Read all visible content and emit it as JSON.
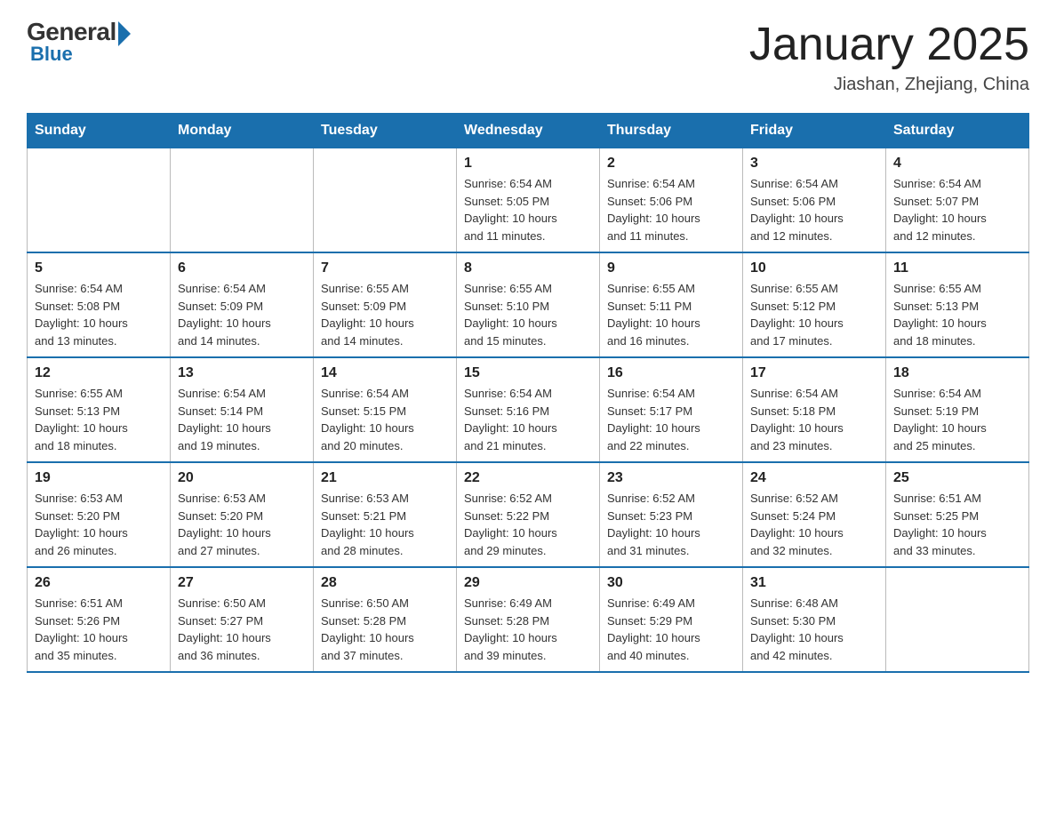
{
  "header": {
    "logo_general": "General",
    "logo_blue": "Blue",
    "month_title": "January 2025",
    "location": "Jiashan, Zhejiang, China"
  },
  "calendar": {
    "days_of_week": [
      "Sunday",
      "Monday",
      "Tuesday",
      "Wednesday",
      "Thursday",
      "Friday",
      "Saturday"
    ],
    "weeks": [
      [
        {
          "day": "",
          "info": ""
        },
        {
          "day": "",
          "info": ""
        },
        {
          "day": "",
          "info": ""
        },
        {
          "day": "1",
          "info": "Sunrise: 6:54 AM\nSunset: 5:05 PM\nDaylight: 10 hours\nand 11 minutes."
        },
        {
          "day": "2",
          "info": "Sunrise: 6:54 AM\nSunset: 5:06 PM\nDaylight: 10 hours\nand 11 minutes."
        },
        {
          "day": "3",
          "info": "Sunrise: 6:54 AM\nSunset: 5:06 PM\nDaylight: 10 hours\nand 12 minutes."
        },
        {
          "day": "4",
          "info": "Sunrise: 6:54 AM\nSunset: 5:07 PM\nDaylight: 10 hours\nand 12 minutes."
        }
      ],
      [
        {
          "day": "5",
          "info": "Sunrise: 6:54 AM\nSunset: 5:08 PM\nDaylight: 10 hours\nand 13 minutes."
        },
        {
          "day": "6",
          "info": "Sunrise: 6:54 AM\nSunset: 5:09 PM\nDaylight: 10 hours\nand 14 minutes."
        },
        {
          "day": "7",
          "info": "Sunrise: 6:55 AM\nSunset: 5:09 PM\nDaylight: 10 hours\nand 14 minutes."
        },
        {
          "day": "8",
          "info": "Sunrise: 6:55 AM\nSunset: 5:10 PM\nDaylight: 10 hours\nand 15 minutes."
        },
        {
          "day": "9",
          "info": "Sunrise: 6:55 AM\nSunset: 5:11 PM\nDaylight: 10 hours\nand 16 minutes."
        },
        {
          "day": "10",
          "info": "Sunrise: 6:55 AM\nSunset: 5:12 PM\nDaylight: 10 hours\nand 17 minutes."
        },
        {
          "day": "11",
          "info": "Sunrise: 6:55 AM\nSunset: 5:13 PM\nDaylight: 10 hours\nand 18 minutes."
        }
      ],
      [
        {
          "day": "12",
          "info": "Sunrise: 6:55 AM\nSunset: 5:13 PM\nDaylight: 10 hours\nand 18 minutes."
        },
        {
          "day": "13",
          "info": "Sunrise: 6:54 AM\nSunset: 5:14 PM\nDaylight: 10 hours\nand 19 minutes."
        },
        {
          "day": "14",
          "info": "Sunrise: 6:54 AM\nSunset: 5:15 PM\nDaylight: 10 hours\nand 20 minutes."
        },
        {
          "day": "15",
          "info": "Sunrise: 6:54 AM\nSunset: 5:16 PM\nDaylight: 10 hours\nand 21 minutes."
        },
        {
          "day": "16",
          "info": "Sunrise: 6:54 AM\nSunset: 5:17 PM\nDaylight: 10 hours\nand 22 minutes."
        },
        {
          "day": "17",
          "info": "Sunrise: 6:54 AM\nSunset: 5:18 PM\nDaylight: 10 hours\nand 23 minutes."
        },
        {
          "day": "18",
          "info": "Sunrise: 6:54 AM\nSunset: 5:19 PM\nDaylight: 10 hours\nand 25 minutes."
        }
      ],
      [
        {
          "day": "19",
          "info": "Sunrise: 6:53 AM\nSunset: 5:20 PM\nDaylight: 10 hours\nand 26 minutes."
        },
        {
          "day": "20",
          "info": "Sunrise: 6:53 AM\nSunset: 5:20 PM\nDaylight: 10 hours\nand 27 minutes."
        },
        {
          "day": "21",
          "info": "Sunrise: 6:53 AM\nSunset: 5:21 PM\nDaylight: 10 hours\nand 28 minutes."
        },
        {
          "day": "22",
          "info": "Sunrise: 6:52 AM\nSunset: 5:22 PM\nDaylight: 10 hours\nand 29 minutes."
        },
        {
          "day": "23",
          "info": "Sunrise: 6:52 AM\nSunset: 5:23 PM\nDaylight: 10 hours\nand 31 minutes."
        },
        {
          "day": "24",
          "info": "Sunrise: 6:52 AM\nSunset: 5:24 PM\nDaylight: 10 hours\nand 32 minutes."
        },
        {
          "day": "25",
          "info": "Sunrise: 6:51 AM\nSunset: 5:25 PM\nDaylight: 10 hours\nand 33 minutes."
        }
      ],
      [
        {
          "day": "26",
          "info": "Sunrise: 6:51 AM\nSunset: 5:26 PM\nDaylight: 10 hours\nand 35 minutes."
        },
        {
          "day": "27",
          "info": "Sunrise: 6:50 AM\nSunset: 5:27 PM\nDaylight: 10 hours\nand 36 minutes."
        },
        {
          "day": "28",
          "info": "Sunrise: 6:50 AM\nSunset: 5:28 PM\nDaylight: 10 hours\nand 37 minutes."
        },
        {
          "day": "29",
          "info": "Sunrise: 6:49 AM\nSunset: 5:28 PM\nDaylight: 10 hours\nand 39 minutes."
        },
        {
          "day": "30",
          "info": "Sunrise: 6:49 AM\nSunset: 5:29 PM\nDaylight: 10 hours\nand 40 minutes."
        },
        {
          "day": "31",
          "info": "Sunrise: 6:48 AM\nSunset: 5:30 PM\nDaylight: 10 hours\nand 42 minutes."
        },
        {
          "day": "",
          "info": ""
        }
      ]
    ]
  }
}
